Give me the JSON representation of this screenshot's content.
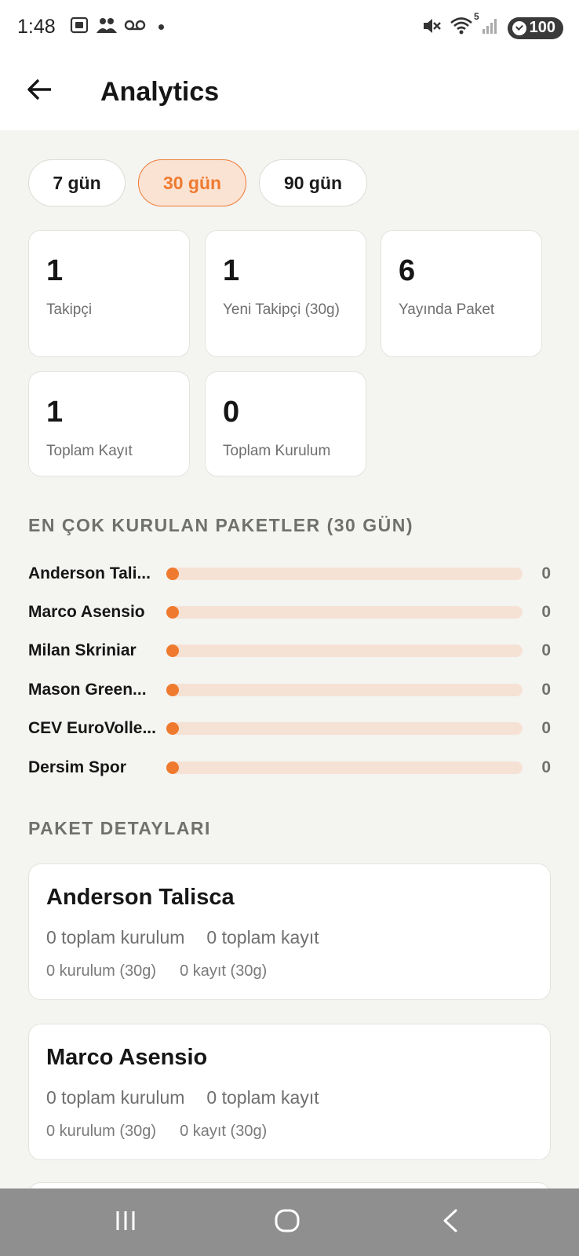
{
  "status_bar": {
    "time": "1:48",
    "left_icons": [
      "screenshot-icon",
      "people-icon",
      "voicemail-icon",
      "notification-dot-icon"
    ],
    "right_icons": [
      "mute-icon",
      "wifi-icon",
      "signal-icon"
    ],
    "wifi_label": "5",
    "battery": "100"
  },
  "app_bar": {
    "back_icon": "arrow-left-icon",
    "title": "Analytics"
  },
  "ranges": {
    "options": [
      "7 gün",
      "30 gün",
      "90 gün"
    ],
    "selected": "30 gün"
  },
  "stats": [
    {
      "value": "1",
      "label": "Takipçi"
    },
    {
      "value": "1",
      "label": "Yeni Takipçi (30g)"
    },
    {
      "value": "6",
      "label": "Yayında Paket"
    },
    {
      "value": "1",
      "label": "Toplam Kayıt"
    },
    {
      "value": "0",
      "label": "Toplam Kurulum"
    }
  ],
  "top_packages": {
    "title": "EN ÇOK KURULAN PAKETLER (30 GÜN)",
    "items": [
      {
        "name": "Anderson Tali...",
        "value": "0",
        "level": 0
      },
      {
        "name": "Marco Asensio",
        "value": "0",
        "level": 0
      },
      {
        "name": "Milan Skriniar",
        "value": "0",
        "level": 0
      },
      {
        "name": "Mason Green...",
        "value": "0",
        "level": 0
      },
      {
        "name": "CEV EuroVolle...",
        "value": "0",
        "level": 0
      },
      {
        "name": "Dersim Spor",
        "value": "0",
        "level": 0
      }
    ]
  },
  "package_details": {
    "title": "PAKET DETAYLARI",
    "items": [
      {
        "name": "Anderson Talisca",
        "total_installs": "0 toplam kurulum",
        "total_subscriptions": "0 toplam kayıt",
        "installs_30": "0 kurulum (30g)",
        "subscriptions_30": "0 kayıt (30g)"
      },
      {
        "name": "Marco Asensio",
        "total_installs": "0 toplam kurulum",
        "total_subscriptions": "0 toplam kayıt",
        "installs_30": "0 kurulum (30g)",
        "subscriptions_30": "0 kayıt (30g)"
      }
    ]
  },
  "nav_bar": {
    "icons": [
      "recent-apps-icon",
      "home-icon",
      "back-icon"
    ]
  },
  "colors": {
    "accent": "#ef7a2f",
    "accent_soft": "#fbe3d4",
    "background": "#f4f4f1",
    "card": "#ffffff",
    "muted_text": "#6f716c"
  }
}
